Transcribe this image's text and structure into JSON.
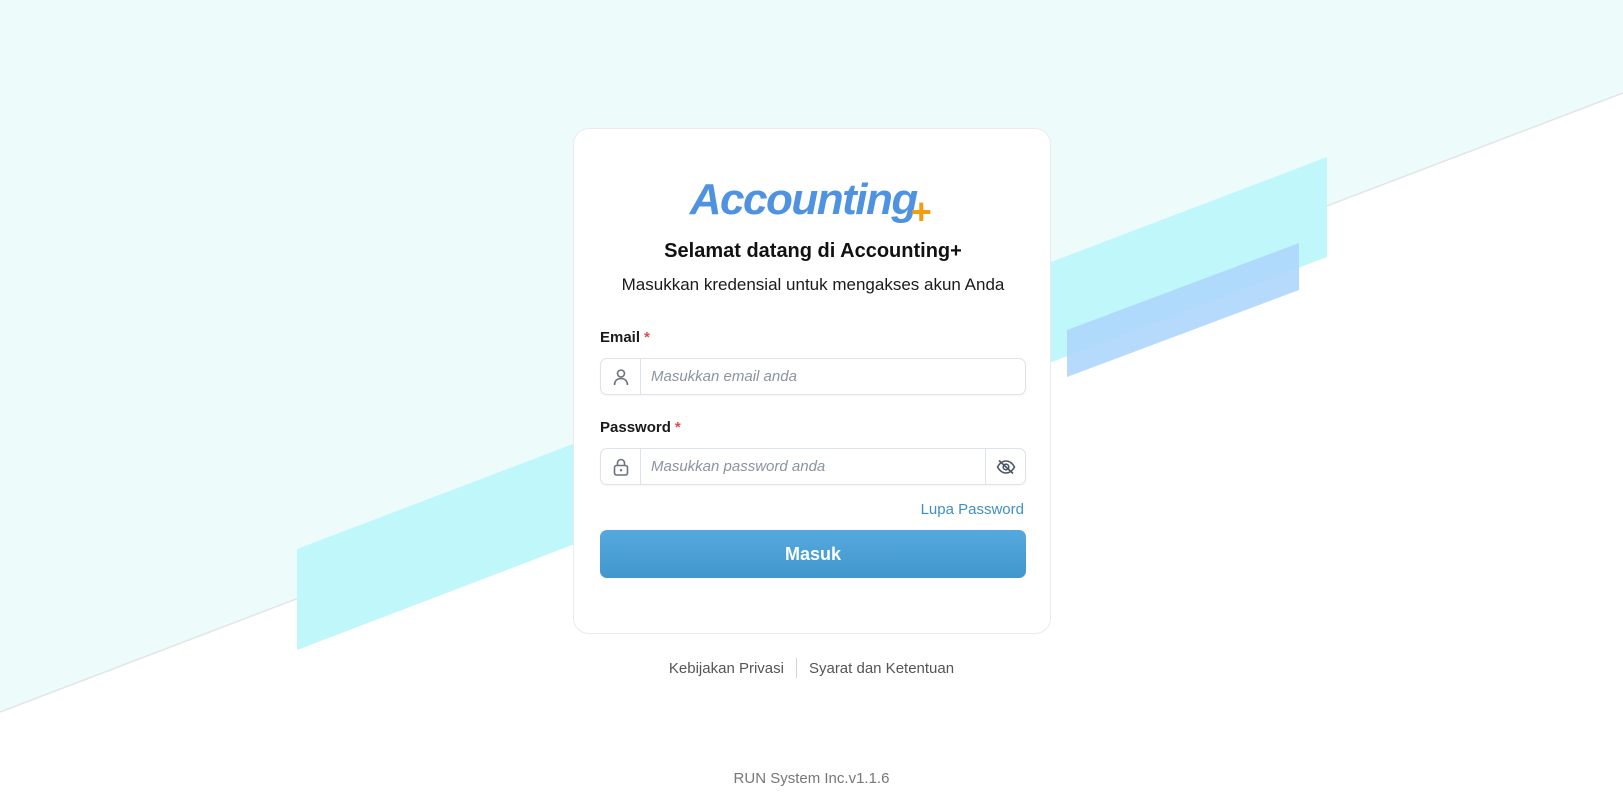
{
  "brand": {
    "logo_text": "Accounting",
    "logo_plus": "+",
    "primary_color": "#4f92e0",
    "accent_color": "#f39c12"
  },
  "login": {
    "title": "Selamat datang di Accounting+",
    "subtitle": "Masukkan kredensial untuk mengakses akun Anda",
    "email": {
      "label": "Email",
      "required_mark": "*",
      "placeholder": "Masukkan email anda",
      "value": "",
      "icon": "user-icon"
    },
    "password": {
      "label": "Password",
      "required_mark": "*",
      "placeholder": "Masukkan password anda",
      "value": "",
      "icon": "lock-icon",
      "toggle_icon": "eye-off-icon"
    },
    "forgot_password": "Lupa Password",
    "submit_label": "Masuk",
    "button_color": "#4a9fd5"
  },
  "footer": {
    "privacy": "Kebijakan Privasi",
    "terms": "Syarat dan Ketentuan",
    "version": "RUN System Inc.v1.1.6"
  }
}
